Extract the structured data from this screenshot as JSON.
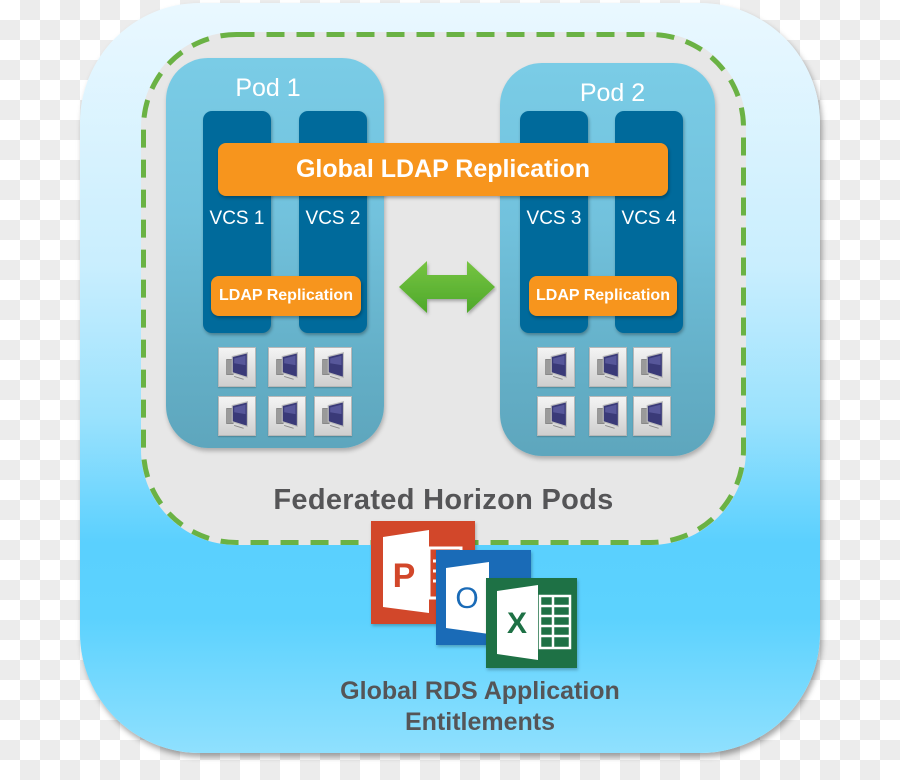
{
  "diagram": {
    "federation": {
      "label": "Federated Horizon Pods"
    },
    "global_replication": {
      "label": "Global LDAP Replication"
    },
    "pods": [
      {
        "title": "Pod 1",
        "servers": [
          {
            "label": "VCS 1"
          },
          {
            "label": "VCS 2"
          }
        ],
        "local_replication_label": "LDAP Replication",
        "desktop_count": 6
      },
      {
        "title": "Pod 2",
        "servers": [
          {
            "label": "VCS 3"
          },
          {
            "label": "VCS 4"
          }
        ],
        "local_replication_label": "LDAP Replication",
        "desktop_count": 6
      }
    ],
    "connector": {
      "icon": "bidirectional-arrow-icon",
      "meaning": "pod-to-pod sync"
    },
    "applications": {
      "icons": [
        {
          "name": "powerpoint-icon",
          "letter": "P",
          "color": "#d2472a"
        },
        {
          "name": "outlook-icon",
          "letter": "O",
          "color": "#1a6bb7"
        },
        {
          "name": "excel-icon",
          "letter": "X",
          "color": "#1e7145"
        }
      ],
      "label_line1": "Global RDS Application",
      "label_line2": "Entitlements"
    }
  },
  "colors": {
    "federation_border": "#6ab244",
    "orange_accent": "#f7951d",
    "vcs_blue": "#006a9b",
    "pod_blue": "#72c2dd",
    "arrow_green": "#5db133",
    "label_gray": "#555557"
  }
}
